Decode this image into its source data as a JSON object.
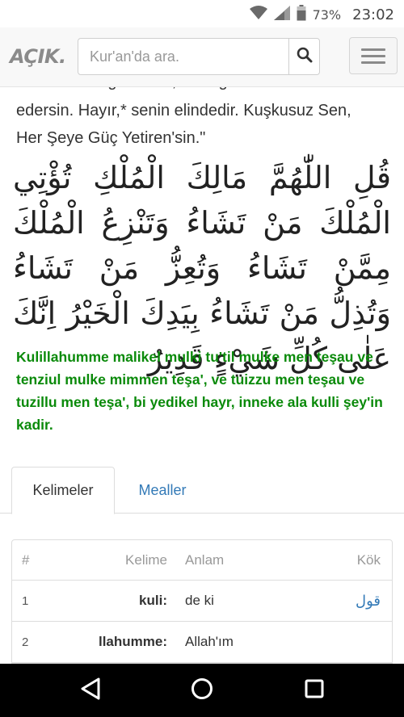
{
  "status_bar": {
    "battery_percent": "73%",
    "time": "23:02",
    "icons": [
      "wifi-icon",
      "signal-icon",
      "battery-icon"
    ]
  },
  "header": {
    "brand": "AÇIK.",
    "search_placeholder": "Kur'an'da ara.",
    "search_icon": "search-icon",
    "menu_icon": "hamburger-menu-icon"
  },
  "verse": {
    "translation_lines": [
      "alirsin. Dilediğini \"aziz, dilediğini \"zelil\"",
      "edersin. Hayır,* senin elindedir. Kuşkusuz Sen,",
      "Her Şeye Güç Yetiren'sin.\""
    ],
    "arabic": "قُلِ اللّٰهُمَّ مَالِكَ الْمُلْكِ تُؤْتِي الْمُلْكَ مَنْ تَشَاءُ وَتَنْزِعُ الْمُلْكَ مِمَّنْ تَشَاءُ وَتُعِزُّ مَنْ تَشَاءُ وَتُذِلُّ مَنْ تَشَاءُ بِيَدِكَ الْخَيْرُ اِنَّكَ عَلٰى كُلِّ شَيْءٍ قَدِيرٌ",
    "transliteration": "Kulillahumme malikel mulki tu'til mulke men teşau ve tenziul mulke mimmen teşa', ve tuizzu men teşau ve tuzillu men teşa', bi yedikel hayr, inneke ala kulli şey'in kadir."
  },
  "tabs": [
    {
      "label": "Kelimeler",
      "active": true
    },
    {
      "label": "Mealler",
      "active": false
    }
  ],
  "table": {
    "headers": {
      "num": "#",
      "word": "Kelime",
      "meaning": "Anlam",
      "root": "Kök"
    },
    "rows": [
      {
        "num": "1",
        "word": "kuli",
        "meaning": "de ki",
        "root": "قول"
      },
      {
        "num": "2",
        "word": "llahumme",
        "meaning": "Allah'ım",
        "root": ""
      }
    ]
  },
  "navbar": {
    "icons": [
      "back-icon",
      "home-icon",
      "recents-icon"
    ]
  },
  "colors": {
    "accent_link": "#337ab7",
    "transliteration_green": "#0a8a0a",
    "brand_gray": "#8a8a8a"
  }
}
